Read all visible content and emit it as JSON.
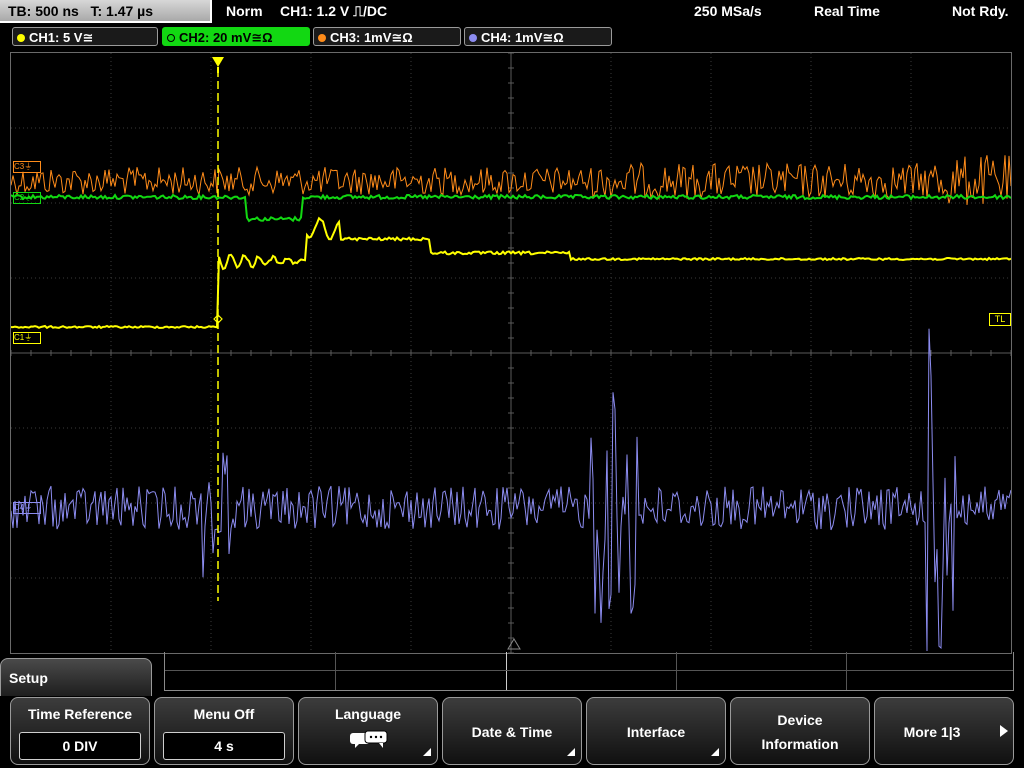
{
  "top_bar": {
    "timebase": "TB: 500 ns",
    "trigger_time": "T: 1.47 µs",
    "acq_mode": "Norm",
    "trigger_setting": "CH1: 1.2 V ⎍/DC",
    "sample_rate": "250 MSa/s",
    "acq_type": "Real Time",
    "status": "Not Rdy."
  },
  "channels": [
    {
      "label": "CH1: 5 V≅",
      "color": "#ffff00",
      "active": false
    },
    {
      "label": "CH2: 20 mV≅Ω",
      "color": "#00ff00",
      "active": true
    },
    {
      "label": "CH3: 1mV≅Ω",
      "color": "#ff8c1a",
      "active": false
    },
    {
      "label": "CH4: 1mV≅Ω",
      "color": "#8c8cf0",
      "active": false
    }
  ],
  "markers": {
    "c1": "C1",
    "c2": "C2",
    "c3": "C3",
    "c4": "C4",
    "trigger_level": "TL"
  },
  "menu": {
    "title": "Setup",
    "softkeys": [
      {
        "label": "Time Reference",
        "value": "0 DIV"
      },
      {
        "label": "Menu Off",
        "value": "4 s"
      },
      {
        "label": "Language",
        "icon": "speech-bubbles-icon"
      },
      {
        "label": "Date & Time"
      },
      {
        "label": "Interface"
      },
      {
        "label_line1": "Device",
        "label_line2": "Information"
      },
      {
        "label": "More 1|3",
        "icon": "right-arrow-icon"
      }
    ]
  }
}
